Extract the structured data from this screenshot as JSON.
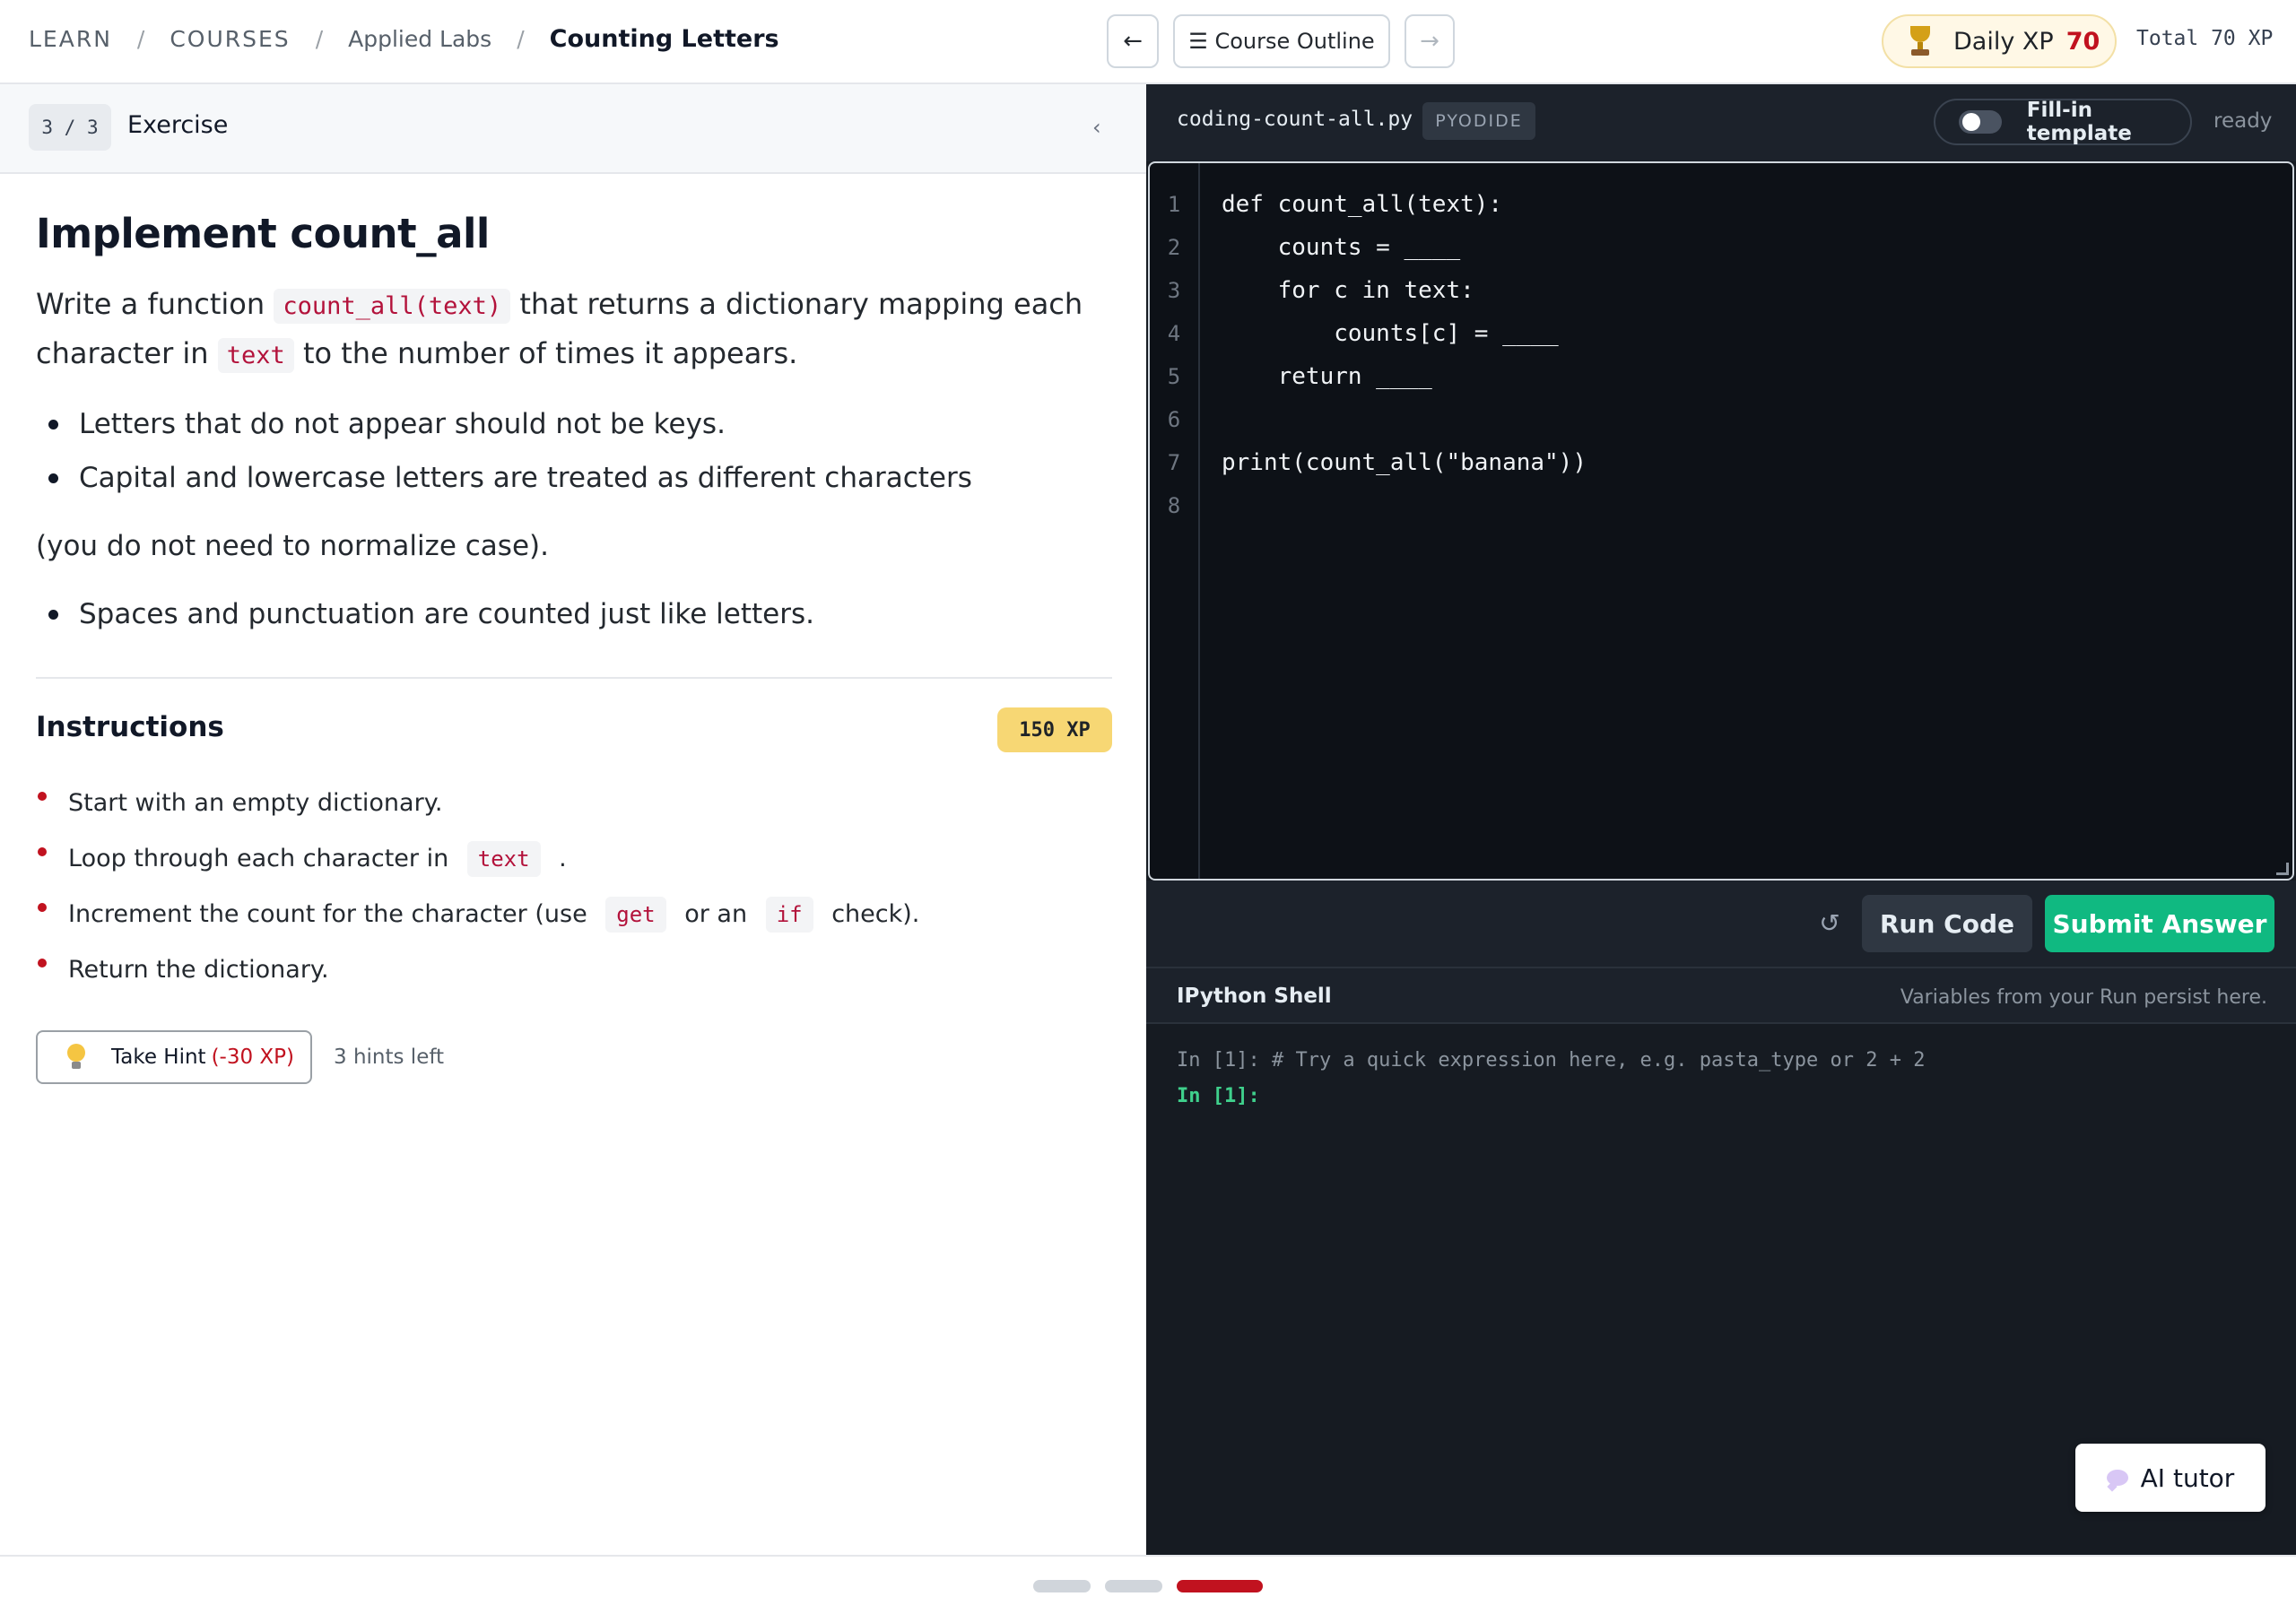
{
  "breadcrumb": {
    "learn": "LEARN",
    "courses": "COURSES",
    "course": "Applied Labs",
    "current": "Counting Letters",
    "sep": "/"
  },
  "nav": {
    "prev_icon": "←",
    "outline_label": "☰ Course Outline",
    "next_icon": "→"
  },
  "xp": {
    "daily_label": "Daily XP",
    "daily_value": "70",
    "total_label": "Total 70 XP"
  },
  "exercise": {
    "counter": "3 / 3",
    "type": "Exercise",
    "collapse_icon": "‹",
    "title": "Implement count_all",
    "desc_1": "Write a function",
    "desc_code_1": "count_all(text)",
    "desc_2": "that returns a dictionary mapping each character in",
    "desc_code_2": "text",
    "desc_3": "to the number of times it appears.",
    "bullets": [
      "Letters that do not appear should not be keys.",
      "Capital and lowercase letters are treated as different characters"
    ],
    "para": "(you do not need to normalize case).",
    "bullets_2": [
      "Spaces and punctuation are counted just like letters."
    ]
  },
  "instructions": {
    "title": "Instructions",
    "xp_badge": "150 XP",
    "step_1": "Start with an empty dictionary.",
    "step_2_a": "Loop through each character in",
    "step_2_code": "text",
    "step_2_b": ".",
    "step_3_a": "Increment the count for the character (use",
    "step_3_code_1": "get",
    "step_3_b": "or an",
    "step_3_code_2": "if",
    "step_3_c": "check).",
    "step_4": "Return the dictionary.",
    "hint_label": "Take Hint",
    "hint_cost": "(-30 XP)",
    "hints_left": "3 hints left"
  },
  "editor": {
    "filename": "coding-count-all.py",
    "runtime": "PYODIDE",
    "toggle_label": "Fill-in template",
    "toggle_on": false,
    "status": "ready",
    "line_numbers": [
      "1",
      "2",
      "3",
      "4",
      "5",
      "6",
      "7",
      "8"
    ],
    "code_lines": [
      "def count_all(text):",
      "    counts = ____",
      "    for c in text:",
      "        counts[c] = ____",
      "    return ____",
      "",
      "print(count_all(\"banana\"))",
      ""
    ],
    "reset_icon": "↺",
    "run_label": "Run Code",
    "submit_label": "Submit Answer"
  },
  "shell": {
    "title": "IPython Shell",
    "note": "Variables from your Run persist here.",
    "line_1": "In [1]: # Try a quick expression here, e.g. pasta_type or 2 + 2",
    "prompt": "In [1]:",
    "tutor_label": "AI tutor"
  },
  "progress": {
    "steps_total": 3,
    "current_step": 3
  },
  "colors": {
    "accent_red": "#c1121f",
    "submit_green": "#10b981",
    "editor_bg": "#0d1117",
    "xp_badge": "#f7d774"
  }
}
